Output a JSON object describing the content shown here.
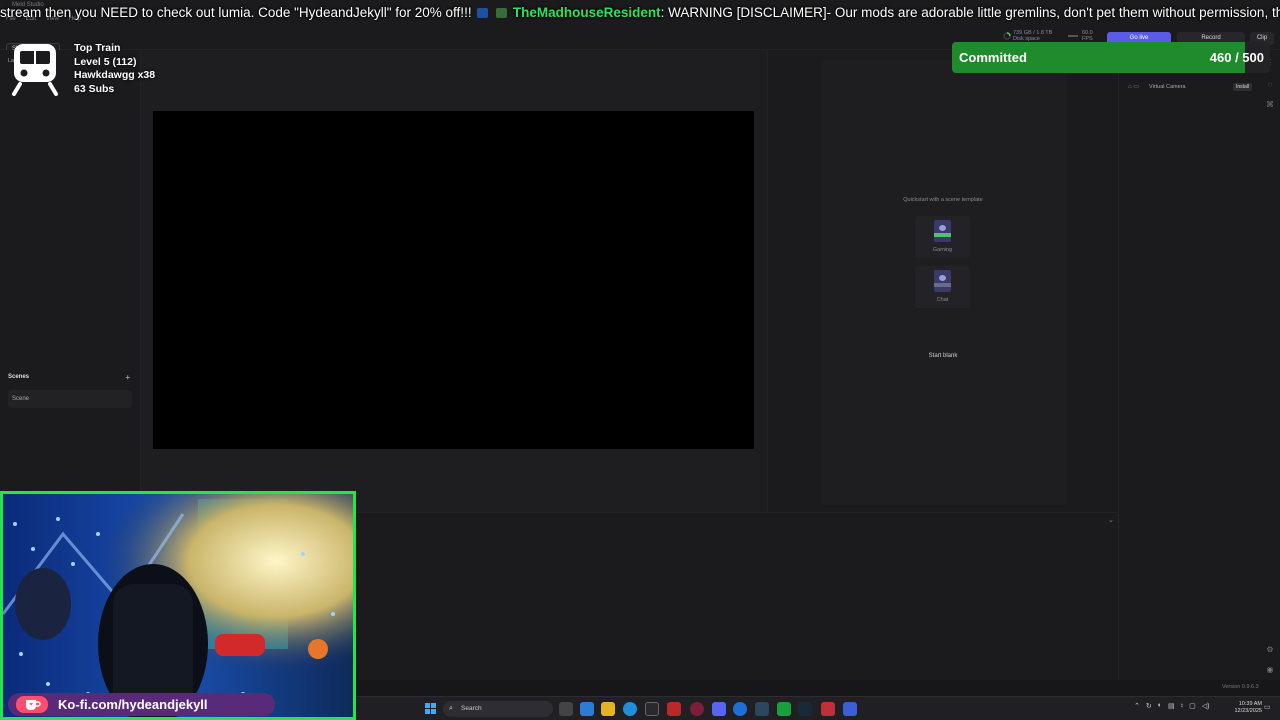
{
  "app": {
    "window_title": "Meld Studio",
    "menu": [
      "File",
      "Edit",
      "View",
      "Help"
    ],
    "share_feedback": "Share feedback",
    "disk_stat": "739 GB / 1.8 TB",
    "disk_label": "Disk space",
    "fps_value": "60.0",
    "fps_label": "FPS",
    "go_live": "Go live",
    "record": "Record",
    "clip": "Clip",
    "layers_label": "Layers",
    "scenes_title": "Scenes",
    "scenes_add": "+",
    "scene_item": "Scene",
    "quickstart_label": "Quickstart with a scene template",
    "templates": [
      {
        "label": "Gaming"
      },
      {
        "label": "Chat"
      }
    ],
    "start_blank": "Start blank",
    "virtual_camera": "Virtual Camera",
    "install": "Install",
    "version": "Version 0.9.6.3",
    "collapse_icon": "chevron-down-icon"
  },
  "overlay": {
    "ticker_prefix": "stream then you NEED to check out lumia. Code \"HydeandJekyll\" for 20% off!!!",
    "ticker_user": "TheMadhouseResident",
    "ticker_message": ": WARNING [DISCLAIMER]- Our mods are adorable little gremlins, don't pet them without permission, they WILL bite",
    "train": {
      "title": "Top Train",
      "level": "Level 5  (112)",
      "top_user": "Hawkdawgg x38",
      "subs": "63 Subs"
    },
    "goal": {
      "label": "Committed",
      "count": "460 / 500",
      "progress": 0.92,
      "color": "#1f8b2c"
    },
    "kofi": "Ko-fi.com/hydeandjekyll",
    "webcam_border": "#22e64a"
  },
  "taskbar": {
    "search_label": "Search",
    "time": "10:39 AM",
    "date": "12/23/2025"
  }
}
